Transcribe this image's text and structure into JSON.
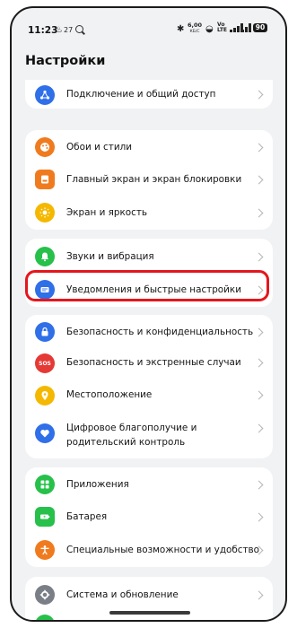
{
  "status_bar": {
    "time": "11:23",
    "temperature": "27",
    "speed_value": "6,00",
    "speed_unit": "КБ/С",
    "volte_top": "Vo",
    "volte_bottom": "LTE",
    "battery": "90"
  },
  "page_title": "Настройки",
  "groups": [
    {
      "items": [
        {
          "label": "Подключение и общий доступ",
          "icon": "connection-icon",
          "color": "#2f6fe8"
        }
      ]
    },
    {
      "items": [
        {
          "label": "Обои и стили",
          "icon": "palette-icon",
          "color": "#f07b1f"
        },
        {
          "label": "Главный экран и экран блокировки",
          "icon": "home-screen-icon",
          "color": "#f07b1f"
        },
        {
          "label": "Экран и яркость",
          "icon": "brightness-icon",
          "color": "#f5b800"
        }
      ]
    },
    {
      "items": [
        {
          "label": "Звуки и вибрация",
          "icon": "bell-icon",
          "color": "#27c04a"
        },
        {
          "label": "Уведомления и быстрые настройки",
          "icon": "notification-icon",
          "color": "#2f6fe8"
        }
      ]
    },
    {
      "items": [
        {
          "label": "Безопасность и конфиденциальность",
          "icon": "lock-icon",
          "color": "#2f6fe8"
        },
        {
          "label": "Безопасность и экстренные случаи",
          "icon": "sos-icon",
          "color": "#e53935",
          "icon_text": "SOS"
        },
        {
          "label": "Местоположение",
          "icon": "location-icon",
          "color": "#f5b800"
        },
        {
          "label": "Цифровое благополучие и родительский контроль",
          "icon": "heart-icon",
          "color": "#2f6fe8"
        }
      ]
    },
    {
      "items": [
        {
          "label": "Приложения",
          "icon": "apps-icon",
          "color": "#27c04a"
        },
        {
          "label": "Батарея",
          "icon": "battery-icon",
          "color": "#27c04a"
        },
        {
          "label": "Специальные возможности и удобство",
          "icon": "accessibility-icon",
          "color": "#f07b1f"
        }
      ]
    },
    {
      "items": [
        {
          "label": "Система и обновление",
          "icon": "gear-icon",
          "color": "#7a7f87"
        }
      ]
    }
  ],
  "highlight_color": "#e5161d"
}
